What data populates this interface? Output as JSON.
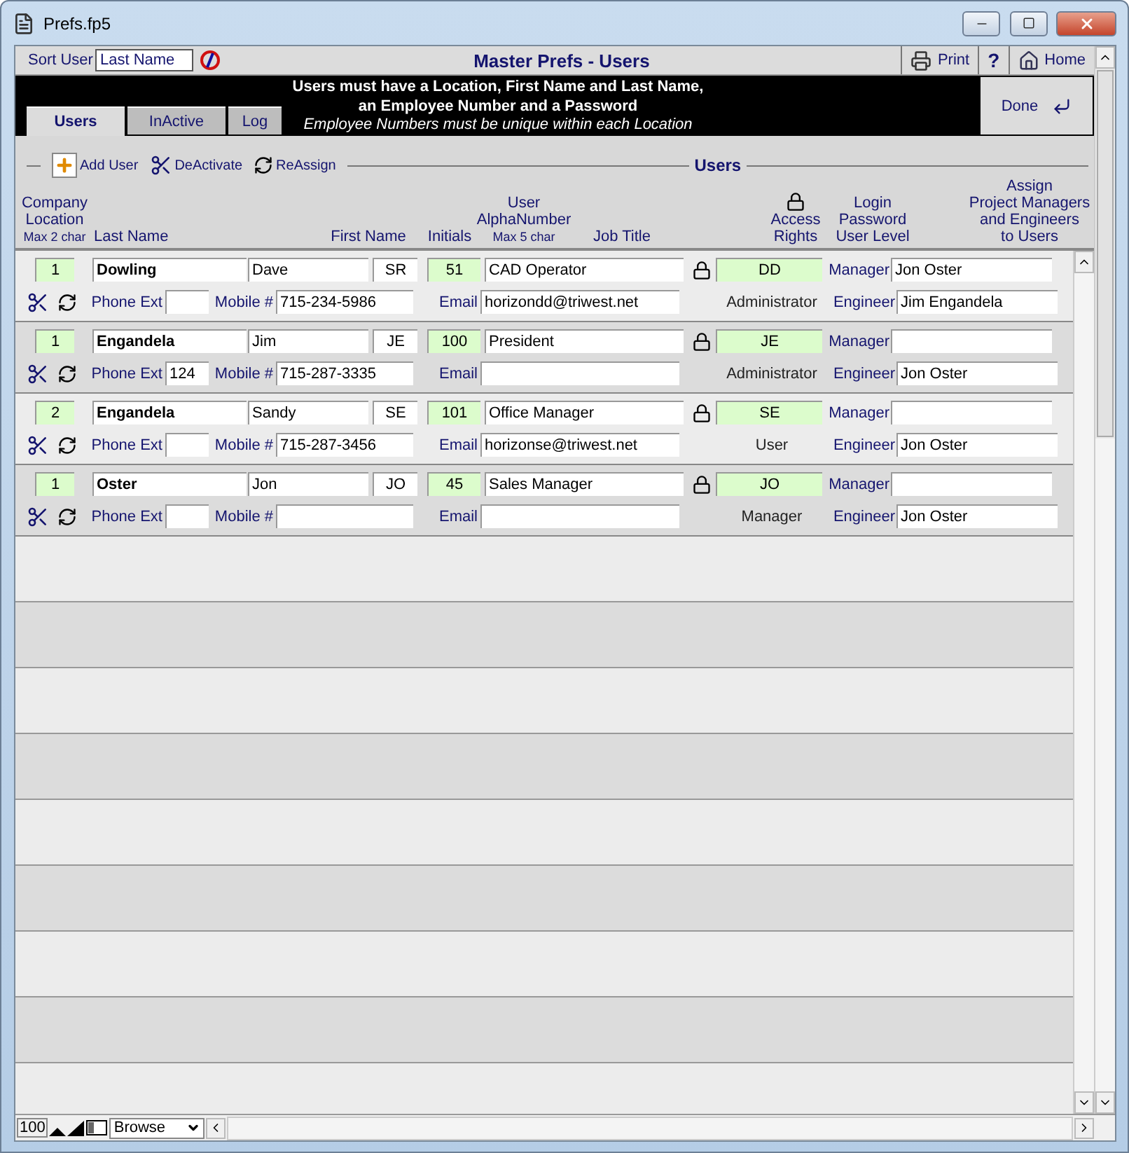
{
  "window": {
    "title": "Prefs.fp5"
  },
  "header": {
    "sort_label": "Sort User",
    "sort_value": "Last Name",
    "title": "Master Prefs - Users",
    "print": "Print",
    "help": "?",
    "home": "Home"
  },
  "banner": {
    "message": "Users must have a Location,  First Name and Last Name,\nan Employee Number and a Password",
    "note": "Employee Numbers must be unique within each Location",
    "done": "Done"
  },
  "tabs": [
    {
      "label": "Users",
      "selected": true
    },
    {
      "label": "InActive",
      "selected": false
    },
    {
      "label": "Log",
      "selected": false
    }
  ],
  "toolbar": {
    "actions": [
      {
        "kind": "add",
        "label": "Add User"
      },
      {
        "kind": "deactivate",
        "label": "DeActivate"
      },
      {
        "kind": "reassign",
        "label": "ReAssign"
      }
    ],
    "section_title": "Users"
  },
  "columns": {
    "location": "Company\nLocation",
    "location_hint": "Max 2 char",
    "last_name": "Last Name",
    "first_name": "First Name",
    "initials": "Initials",
    "alpha": "User\nAlphaNumber",
    "alpha_hint": "Max 5 char",
    "job_title": "Job Title",
    "access": "Access\nRights",
    "login": "Login\nPassword\nUser Level",
    "assign": "Assign\nProject Managers\nand Engineers\nto Users"
  },
  "records": [
    {
      "location": "1",
      "last_name": "Dowling",
      "first_name": "Dave",
      "initials": "SR",
      "alpha": "51",
      "job_title": "CAD Operator",
      "phone_ext": {
        "label": "Phone Ext"
      },
      "mobile": {
        "label": "Mobile #",
        "value": "715-234-5986"
      },
      "email": {
        "label": "Email",
        "value": "horizondd@triwest.net"
      },
      "login": "DD",
      "user_level": "Administrator",
      "manager": {
        "label": "Manager",
        "value": "Jon Oster"
      },
      "engineer": {
        "label": "Engineer",
        "value": "Jim Engandela"
      }
    },
    {
      "location": "1",
      "last_name": "Engandela",
      "first_name": "Jim",
      "initials": "JE",
      "alpha": "100",
      "job_title": "President",
      "phone_ext": {
        "label": "Phone Ext",
        "value": "124"
      },
      "mobile": {
        "label": "Mobile #",
        "value": "715-287-3335"
      },
      "email": {
        "label": "Email"
      },
      "login": "JE",
      "user_level": "Administrator",
      "manager": {
        "label": "Manager"
      },
      "engineer": {
        "label": "Engineer",
        "value": "Jon Oster"
      }
    },
    {
      "location": "2",
      "last_name": "Engandela",
      "first_name": "Sandy",
      "initials": "SE",
      "alpha": "101",
      "job_title": "Office Manager",
      "phone_ext": {
        "label": "Phone Ext"
      },
      "mobile": {
        "label": "Mobile #",
        "value": "715-287-3456"
      },
      "email": {
        "label": "Email",
        "value": "horizonse@triwest.net"
      },
      "login": "SE",
      "user_level": "User",
      "manager": {
        "label": "Manager"
      },
      "engineer": {
        "label": "Engineer",
        "value": "Jon Oster"
      }
    },
    {
      "location": "1",
      "last_name": "Oster",
      "first_name": "Jon",
      "initials": "JO",
      "alpha": "45",
      "job_title": "Sales Manager",
      "phone_ext": {
        "label": "Phone Ext"
      },
      "mobile": {
        "label": "Mobile #"
      },
      "email": {
        "label": "Email"
      },
      "login": "JO",
      "user_level": "Manager",
      "manager": {
        "label": "Manager"
      },
      "engineer": {
        "label": "Engineer",
        "value": "Jon Oster"
      }
    }
  ],
  "status_bar": {
    "zoom": "100",
    "mode": "Browse"
  }
}
